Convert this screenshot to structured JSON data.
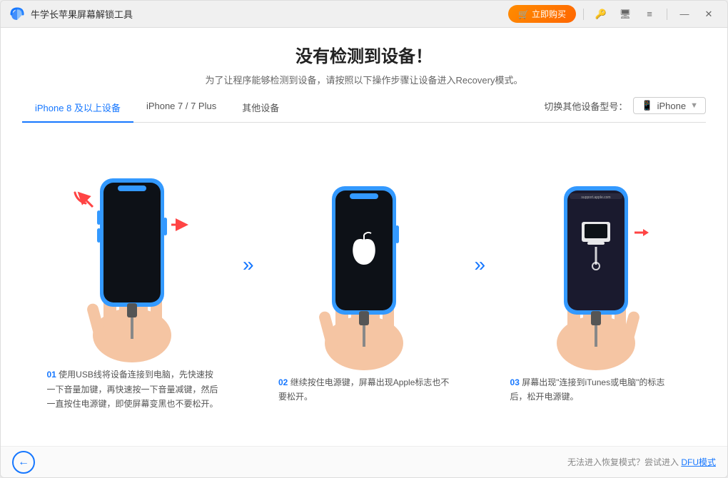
{
  "window": {
    "title": "牛学长苹果屏幕解锁工具"
  },
  "titlebar": {
    "buy_label": "立即购买",
    "key_icon": "🔑",
    "monitor_icon": "🖥",
    "menu_icon": "≡",
    "min_icon": "—",
    "close_icon": "✕"
  },
  "header": {
    "title": "没有检测到设备！",
    "subtitle": "为了让程序能够检测到设备，请按照以下操作步骤让设备进入Recovery模式。"
  },
  "tabs": {
    "items": [
      {
        "label": "iPhone 8 及以上设备",
        "active": true
      },
      {
        "label": "iPhone 7 / 7 Plus",
        "active": false
      },
      {
        "label": "其他设备",
        "active": false
      }
    ],
    "device_selector_label": "切换其他设备型号：",
    "device_icon": "📱",
    "device_value": "iPhone"
  },
  "steps": [
    {
      "num": "01",
      "text": "使用USB线将设备连接到电脑，先快速按一下音量加键，再快速按一下音量减键，然后一直按住电源键，即使屏幕变黑也不要松开。"
    },
    {
      "num": "02",
      "text": "继续按住电源键，屏幕出现Apple标志也不要松开。"
    },
    {
      "num": "03",
      "text": "屏幕出现\"连接到iTunes或电脑\"的标志后，松开电源键。"
    }
  ],
  "footer": {
    "back_icon": "←",
    "hint_text": "无法进入恢复模式？尝试进入",
    "link_text": "DFU模式"
  }
}
